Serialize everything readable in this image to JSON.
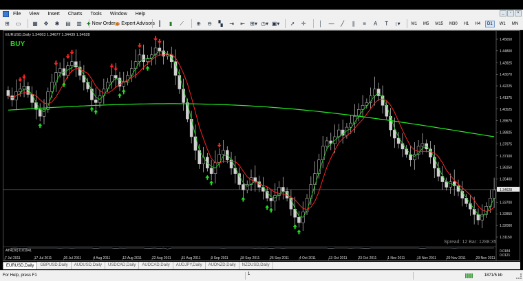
{
  "menu": [
    "File",
    "View",
    "Insert",
    "Charts",
    "Tools",
    "Window",
    "Help"
  ],
  "toolbar": {
    "new_order": "New Order",
    "expert_advisors": "Expert Advisors",
    "timeframes": [
      "M1",
      "M5",
      "M15",
      "M30",
      "H1",
      "H4",
      "D1",
      "W1",
      "MN"
    ],
    "active_timeframe": "D1"
  },
  "chart": {
    "symbol_header": "EURUSD,Daily  1.34663 1.34677 1.34439 1.34628",
    "signal_label": "BUY",
    "spread_text": "Spread: 12  Bar: 1288:35",
    "indicator_label": "ATR(20) 0.01041",
    "current_price": "1.34628",
    "price_ticks": [
      "1.45650",
      "1.44800",
      "1.43925",
      "1.43070",
      "1.42225",
      "1.41375",
      "1.40525",
      "1.39675",
      "1.38825",
      "1.37975",
      "1.37100",
      "1.36250",
      "1.35400",
      "1.34628",
      "1.33700",
      "1.32850",
      "1.32000",
      "1.31150"
    ],
    "atr_ticks": [
      "0.0184",
      "0.0121"
    ],
    "date_ticks": [
      "7 Jul 2011",
      "17 Jul 2011",
      "26 Jul 2011",
      "4 Aug 2011",
      "12 Aug 2011",
      "22 Aug 2011",
      "31 Aug 2011",
      "9 Sep 2011",
      "18 Sep 2011",
      "26 Sep 2011",
      "4 Oct 2011",
      "13 Oct 2011",
      "23 Oct 2011",
      "1 Nov 2011",
      "10 Nov 2011",
      "20 Nov 2011",
      "29 Nov 2011"
    ],
    "colors": {
      "up_arrow": "#22dd22",
      "down_arrow": "#ff2222",
      "fast_ma": "#ff2222",
      "mid_ma": "#22cc22",
      "slow_ma": "#22ee22",
      "candles": "#d0d0d0"
    }
  },
  "chart_data": {
    "type": "candlestick",
    "symbol": "EURUSD",
    "timeframe": "Daily",
    "ylim": [
      1.3115,
      1.4565
    ],
    "close": [
      1.415,
      1.412,
      1.418,
      1.42,
      1.422,
      1.416,
      1.41,
      1.405,
      1.4,
      1.405,
      1.418,
      1.425,
      1.432,
      1.435,
      1.43,
      1.437,
      1.44,
      1.436,
      1.43,
      1.425,
      1.42,
      1.412,
      1.41,
      1.415,
      1.42,
      1.425,
      1.43,
      1.428,
      1.422,
      1.425,
      1.43,
      1.435,
      1.44,
      1.445,
      1.44,
      1.442,
      1.445,
      1.45,
      1.448,
      1.444,
      1.445,
      1.44,
      1.43,
      1.42,
      1.41,
      1.398,
      1.385,
      1.375,
      1.365,
      1.37,
      1.362,
      1.358,
      1.366,
      1.372,
      1.375,
      1.368,
      1.362,
      1.358,
      1.35,
      1.346,
      1.35,
      1.355,
      1.352,
      1.348,
      1.345,
      1.34,
      1.338,
      1.342,
      1.348,
      1.345,
      1.34,
      1.332,
      1.326,
      1.322,
      1.33,
      1.34,
      1.35,
      1.358,
      1.368,
      1.378,
      1.382,
      1.38,
      1.385,
      1.39,
      1.386,
      1.392,
      1.395,
      1.4,
      1.405,
      1.408,
      1.41,
      1.415,
      1.42,
      1.415,
      1.408,
      1.4,
      1.39,
      1.384,
      1.38,
      1.376,
      1.372,
      1.368,
      1.372,
      1.378,
      1.38,
      1.376,
      1.37,
      1.362,
      1.356,
      1.352,
      1.348,
      1.352,
      1.349,
      1.345,
      1.34,
      1.336,
      1.332,
      1.328,
      1.324,
      1.328,
      1.334,
      1.34,
      1.346
    ],
    "up_signals": 14,
    "down_signals": 11
  },
  "tabs": [
    "EURUSD,Daily",
    "GBPUSD,Daily",
    "AUDUSD,Daily",
    "USDCAD,Daily",
    "AUDCAD,Daily",
    "AUDJPY,Daily",
    "AUDNZD,Daily",
    "NZDUSD,Daily"
  ],
  "active_tab": "EURUSD,Daily",
  "status": {
    "help": "For Help, press F1",
    "page": "1",
    "connection": "1871/5 kb"
  }
}
